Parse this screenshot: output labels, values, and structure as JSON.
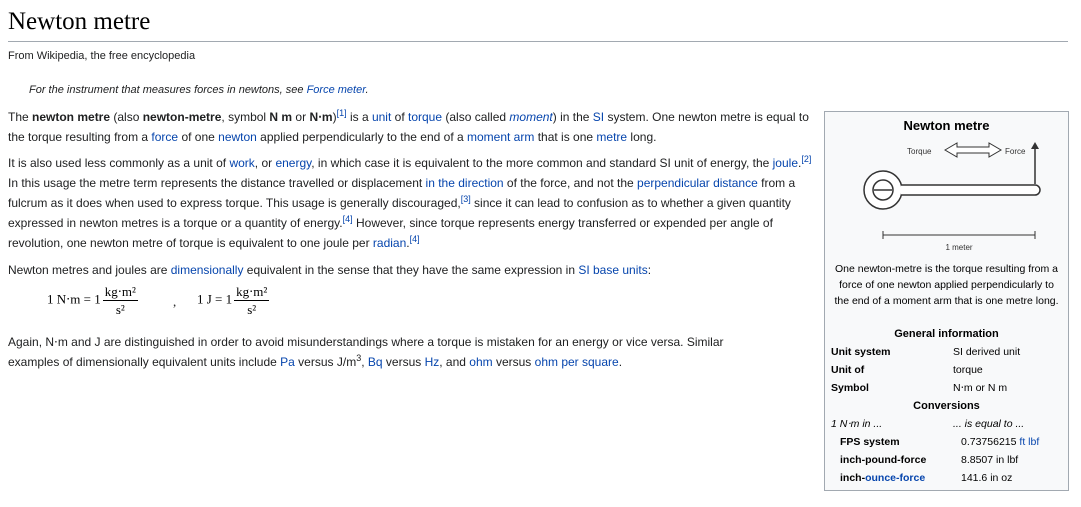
{
  "page": {
    "title": "Newton metre",
    "tagline": "From Wikipedia, the free encyclopedia"
  },
  "hatnote": {
    "prefix": "For the instrument that measures forces in newtons, see ",
    "link": "Force meter",
    "suffix": "."
  },
  "p1": {
    "t1": "The ",
    "b1": "newton metre",
    "t2": " (also ",
    "b2": "newton-metre",
    "t3": ", symbol ",
    "b3": "N m",
    "t4": " or ",
    "b4": "N⋅m",
    "t5": ")",
    "ref1": "[1]",
    "t6": " is a ",
    "l_unit": "unit",
    "t7": " of ",
    "l_torque": "torque",
    "t8": " (also called ",
    "l_moment": "moment",
    "t9": ") in the ",
    "l_si": "SI",
    "t10": " system. One newton metre is equal to the torque resulting from a ",
    "l_force": "force",
    "t11": " of one ",
    "l_newton": "newton",
    "t12": " applied perpendicularly to the end of a ",
    "l_moment_arm": "moment arm",
    "t13": " that is one ",
    "l_metre": "metre",
    "t14": " long."
  },
  "p2": {
    "t1": "It is also used less commonly as a unit of ",
    "l_work": "work",
    "t2": ", or ",
    "l_energy": "energy",
    "t3": ", in which case it is equivalent to the more common and standard SI unit of energy, the ",
    "l_joule": "joule",
    "t4": ".",
    "ref2": "[2]",
    "t5": " In this usage the metre term represents the distance travelled or displacement ",
    "l_direction": "in the direction",
    "t6": " of the force, and not the ",
    "l_perp": "perpendicular distance",
    "t7": " from a fulcrum as it does when used to express torque. This usage is generally discouraged,",
    "ref3": "[3]",
    "t8": " since it can lead to confusion as to whether a given quantity expressed in newton metres is a torque or a quantity of energy.",
    "ref4a": "[4]",
    "t9": " However, since torque represents energy transferred or expended per angle of revolution, one newton metre of torque is equivalent to one joule per ",
    "l_radian": "radian",
    "t10": ".",
    "ref4b": "[4]"
  },
  "p3": {
    "t1": "Newton metres and joules are ",
    "l_dim": "dimensionally",
    "t2": " equivalent in the sense that they have the same expression in ",
    "l_base": "SI base units",
    "t3": ":"
  },
  "equations": {
    "eq1_lhs": "1 N⋅m = 1",
    "eq1_num": "kg⋅m²",
    "eq1_den": "s²",
    "sep": ",",
    "eq2_lhs": "1 J = 1",
    "eq2_num": "kg⋅m²",
    "eq2_den": "s²"
  },
  "p4": {
    "t1": "Again, N⋅m and J are distinguished in order to avoid misunderstandings where a torque is mistaken for an energy or vice versa. Similar examples of dimensionally equivalent units include ",
    "l_pa": "Pa",
    "t2": " versus J/m",
    "sup3": "3",
    "t3": ", ",
    "l_bq": "Bq",
    "t4": " versus ",
    "l_hz": "Hz",
    "t5": ", and ",
    "l_ohm": "ohm",
    "t6": " versus ",
    "l_ohmsq": "ohm per square",
    "t7": "."
  },
  "infobox": {
    "title": "Newton metre",
    "diagram": {
      "torque_label": "Torque",
      "force_label": "Force",
      "length_label": "1 meter"
    },
    "caption": "One newton-metre is the torque resulting from a force of one newton applied perpendicularly to the end of a moment arm that is one metre long.",
    "general_header": "General information",
    "rows": [
      {
        "label": "Unit system",
        "label_is_link": true,
        "value": "SI derived unit",
        "value_is_link": true
      },
      {
        "label": "Unit of",
        "label_is_link": false,
        "value": "torque",
        "value_is_link": true
      },
      {
        "label": "Symbol",
        "label_is_link": false,
        "value": "N⋅m  or  N m",
        "value_is_link": false
      }
    ],
    "conversions_header": "Conversions",
    "conv_left_header": "1 N⋅m in ...",
    "conv_right_header": "... is equal to ...",
    "conversions": [
      {
        "system": "FPS system",
        "value_num": "0.73756215",
        "value_unit": "ft lbf",
        "unit_is_link": true
      },
      {
        "system": "inch-pound-force",
        "value_num": "8.8507",
        "value_unit": "in lbf",
        "unit_is_link": false
      },
      {
        "system_pre": "inch-",
        "system_link": "ounce-force",
        "value_num": "141.6",
        "value_unit": "in oz",
        "unit_is_link": false
      }
    ]
  },
  "colors": {
    "link": "#0645ad",
    "infobox_bg": "#f8f9fa",
    "border": "#a2a9b1"
  }
}
